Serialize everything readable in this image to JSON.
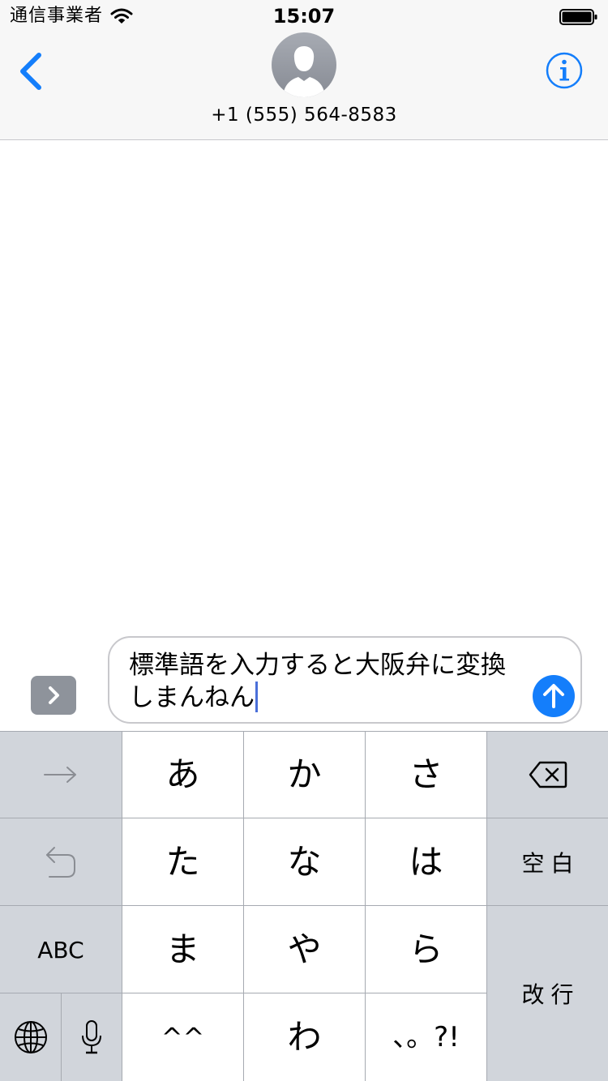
{
  "status_bar": {
    "carrier": "通信事業者",
    "time": "15:07"
  },
  "nav": {
    "contact": "+1 (555) 564-8583"
  },
  "compose": {
    "text_line1": "標準語を入力すると大阪弁に変換",
    "text_line2": "しまんねん"
  },
  "keyboard": {
    "row1": [
      "あ",
      "か",
      "さ"
    ],
    "row2": [
      "た",
      "な",
      "は"
    ],
    "row3": [
      "ま",
      "や",
      "ら"
    ],
    "row4": [
      "^^",
      "わ",
      "、。?!"
    ],
    "space_label": "空白",
    "abc_label": "ABC",
    "return_label": "改行"
  },
  "colors": {
    "accent": "#147efb",
    "caret": "#4a6fd9",
    "keyboard_bg": "#d1d5db"
  },
  "icons": {
    "back": "chevron-left-icon",
    "info": "info-circle-icon",
    "send": "arrow-up-icon",
    "apps": "chevron-right-icon",
    "wifi": "wifi-icon",
    "battery": "battery-icon",
    "next_candidate": "arrow-right-icon",
    "undo": "undo-icon",
    "delete": "backspace-icon",
    "globe": "globe-icon",
    "mic": "microphone-icon"
  }
}
